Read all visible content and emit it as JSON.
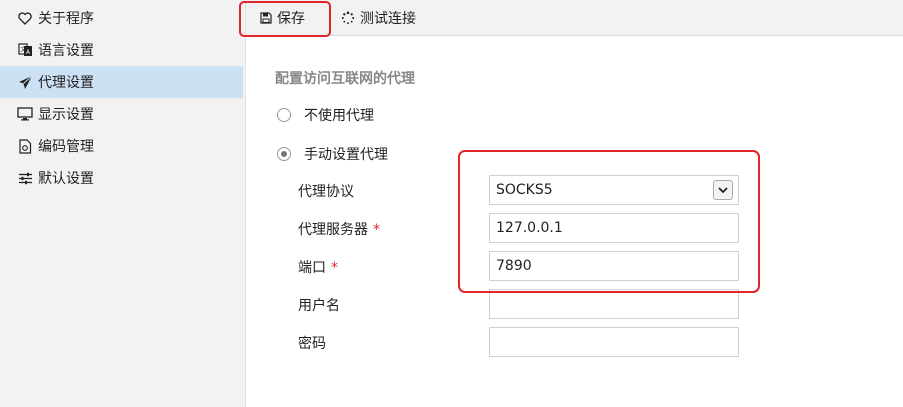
{
  "sidebar": {
    "items": [
      {
        "label": "关于程序",
        "icon": "heart-icon",
        "active": false
      },
      {
        "label": "语言设置",
        "icon": "translate-icon",
        "active": false
      },
      {
        "label": "代理设置",
        "icon": "paper-plane-icon",
        "active": true
      },
      {
        "label": "显示设置",
        "icon": "monitor-icon",
        "active": false
      },
      {
        "label": "编码管理",
        "icon": "code-file-icon",
        "active": false
      },
      {
        "label": "默认设置",
        "icon": "sliders-icon",
        "active": false
      }
    ]
  },
  "toolbar": {
    "save_label": "保存",
    "save_icon": "floppy-disk-icon",
    "test_label": "测试连接",
    "test_icon": "spinner-icon"
  },
  "proxy": {
    "section_title": "配置访问互联网的代理",
    "options": [
      {
        "label": "不使用代理",
        "checked": false
      },
      {
        "label": "手动设置代理",
        "checked": true
      }
    ],
    "fields": {
      "protocol": {
        "label": "代理协议",
        "value": "SOCKS5"
      },
      "server": {
        "label": "代理服务器",
        "value": "127.0.0.1",
        "required_mark": "*"
      },
      "port": {
        "label": "端口",
        "value": "7890",
        "required_mark": "*"
      },
      "username": {
        "label": "用户名",
        "value": ""
      },
      "password": {
        "label": "密码",
        "value": ""
      }
    }
  },
  "colors": {
    "accent_highlight": "#e0262b",
    "active_item_bg": "#cde1f5",
    "sidebar_bg": "#f2f2f2"
  }
}
